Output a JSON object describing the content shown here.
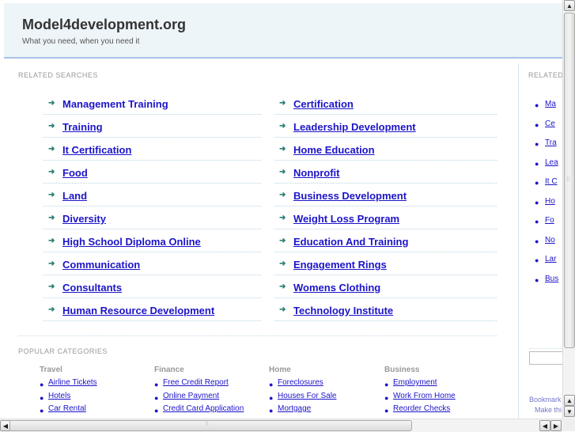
{
  "header": {
    "title": "Model4development.org",
    "tagline": "What you need, when you need it"
  },
  "related_searches": {
    "label": "RELATED SEARCHES",
    "left": [
      "Management Training",
      "Training",
      "It Certification",
      "Food",
      "Land",
      "Diversity",
      "High School Diploma Online",
      "Communication",
      "Consultants",
      "Human Resource Development"
    ],
    "right": [
      "Certification",
      "Leadership Development",
      "Home Education",
      "Nonprofit",
      "Business Development",
      "Weight Loss Program",
      "Education And Training",
      "Engagement Rings",
      "Womens Clothing",
      "Technology Institute"
    ]
  },
  "popular_categories": {
    "label": "POPULAR CATEGORIES",
    "columns": [
      {
        "heading": "Travel",
        "items": [
          "Airline Tickets",
          "Hotels",
          "Car Rental"
        ]
      },
      {
        "heading": "Finance",
        "items": [
          "Free Credit Report",
          "Online Payment",
          "Credit Card Application"
        ]
      },
      {
        "heading": "Home",
        "items": [
          "Foreclosures",
          "Houses For Sale",
          "Mortgage"
        ]
      },
      {
        "heading": "Business",
        "items": [
          "Employment",
          "Work From Home",
          "Reorder Checks"
        ]
      }
    ]
  },
  "right_panel": {
    "label": "RELATED",
    "items": [
      "Ma",
      "Ce",
      "Tra",
      "Lea",
      "It C",
      "Ho",
      "Fo",
      "No",
      "Lar",
      "Bus"
    ],
    "bookmark_text": "Bookmark",
    "make_text": "Make thi"
  },
  "icons": {
    "arrow": "➜",
    "bullet": "●",
    "scroll_up": "▲",
    "scroll_down": "▼",
    "scroll_left": "◀",
    "scroll_right": "▶",
    "grip": "⠿"
  },
  "colors": {
    "link": "#1c14c8",
    "arrow": "#2a7f73",
    "header_bg": "#eef5f8",
    "header_border": "#a9c3e6"
  }
}
